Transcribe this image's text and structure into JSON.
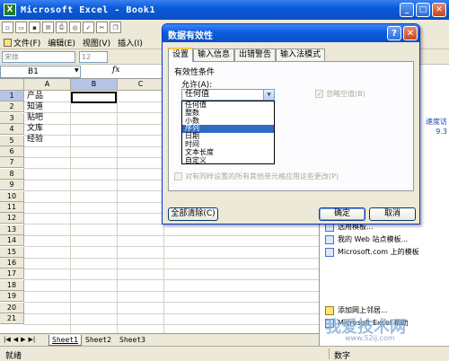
{
  "window": {
    "title": "Microsoft Excel - Book1",
    "app_icon": "X"
  },
  "menus": [
    "文件(F)",
    "编辑(E)",
    "视图(V)",
    "插入(I)"
  ],
  "format": {
    "font": "宋体",
    "size": "12"
  },
  "namebox": {
    "value": "B1",
    "fx": "fx"
  },
  "columns": [
    "A",
    "B",
    "C"
  ],
  "rows": [
    "1",
    "2",
    "3",
    "4",
    "5",
    "6",
    "7",
    "8",
    "9",
    "10",
    "11",
    "12",
    "13",
    "14",
    "15",
    "16",
    "17",
    "18",
    "19",
    "20",
    "21"
  ],
  "cells_a": [
    "产品",
    "知道",
    "贴吧",
    "文库",
    "经验"
  ],
  "sheets": [
    "Sheet1",
    "Sheet2",
    "Sheet3"
  ],
  "status": {
    "left": "就绪",
    "right": "数字"
  },
  "taskpane": {
    "side_text_1": "速度访",
    "side_text_2": "9.3",
    "links": [
      "选用模板...",
      "我的 Web 站点模板...",
      "Microsoft.com 上的模板",
      "添加网上邻居...",
      "Microsoft Excel 帮助"
    ]
  },
  "watermark": {
    "main": "我爱技术网",
    "sub": "www.52ij.com"
  },
  "dialog": {
    "title": "数据有效性",
    "tabs": [
      "设置",
      "输入信息",
      "出错警告",
      "输入法模式"
    ],
    "section_label": "有效性条件",
    "allow_label": "允许(A):",
    "allow_value": "任何值",
    "options": [
      "任何值",
      "整数",
      "小数",
      "序列",
      "日期",
      "时间",
      "文本长度",
      "自定义"
    ],
    "selected_option": "序列",
    "ignore_blank": "忽略空值(B)",
    "apply_all": "对有同样设置的所有其他单元格应用这些更改(P)",
    "clear_all": "全部清除(C)",
    "ok": "确定",
    "cancel": "取消"
  }
}
